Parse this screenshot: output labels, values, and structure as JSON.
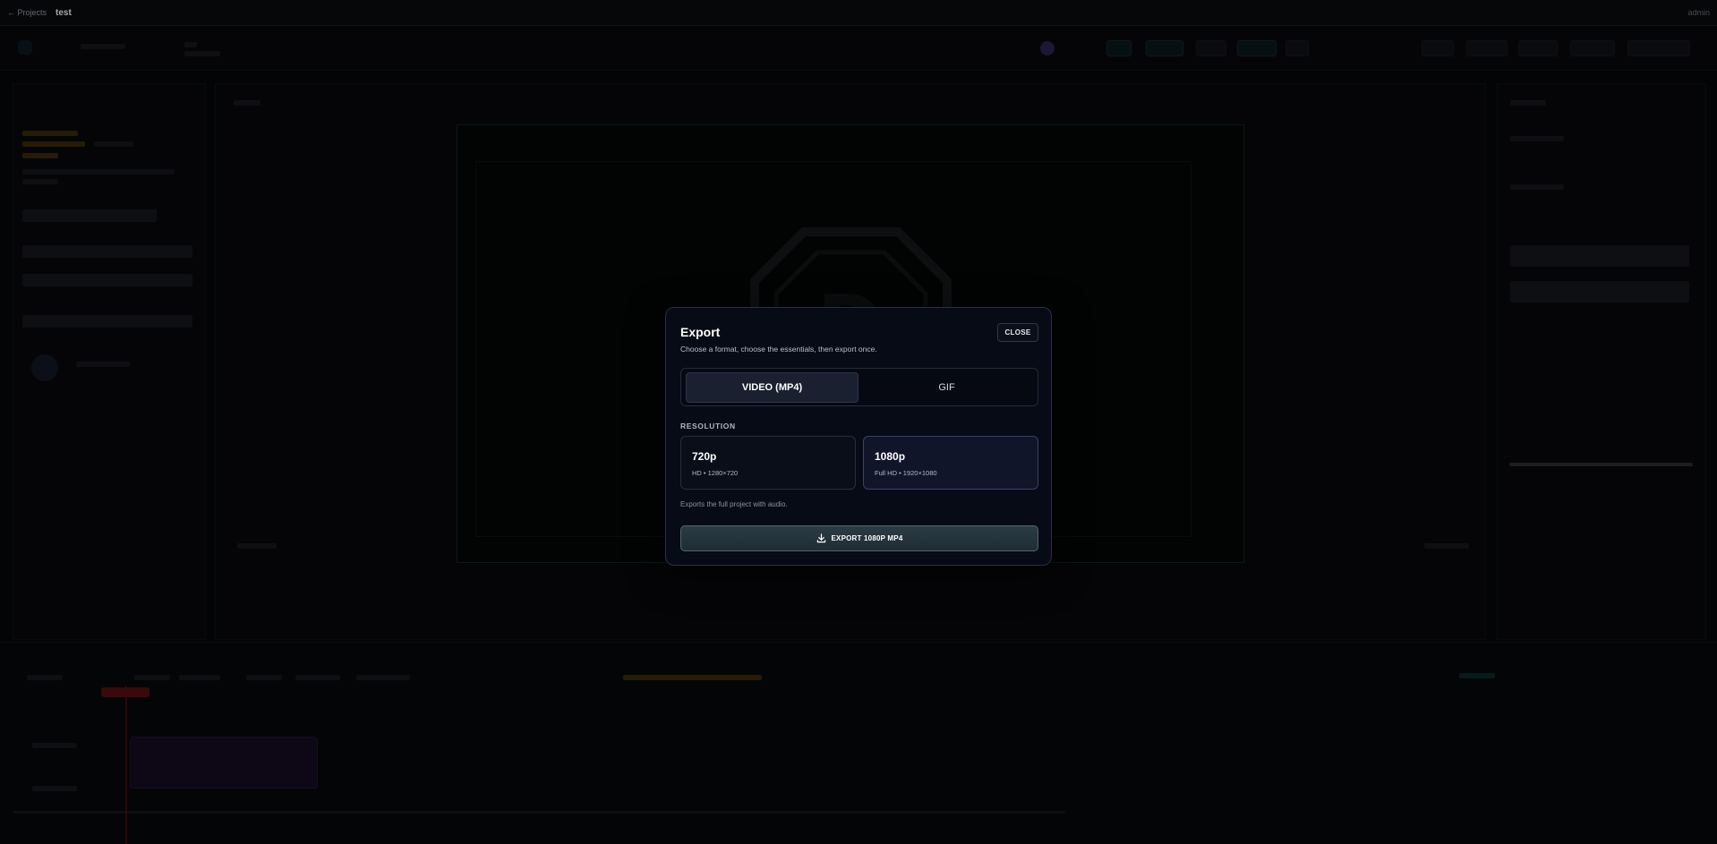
{
  "topbar": {
    "back_label": "← Projects",
    "project_name": "test",
    "user": "admin"
  },
  "modal": {
    "title": "Export",
    "subtitle": "Choose a format, choose the essentials, then export once.",
    "close_label": "CLOSE",
    "format_tabs": [
      {
        "label": "VIDEO (MP4)",
        "selected": true
      },
      {
        "label": "GIF",
        "selected": false
      }
    ],
    "resolution_heading": "RESOLUTION",
    "resolutions": [
      {
        "name": "720p",
        "description": "HD • 1280×720",
        "selected": false
      },
      {
        "name": "1080p",
        "description": "Full HD • 1920×1080",
        "selected": true
      }
    ],
    "note": "Exports the full project with audio.",
    "export_label": "EXPORT 1080P MP4"
  },
  "icons": {
    "download": "download-icon"
  },
  "colors": {
    "modal_bg": "#070b16",
    "accent": "#2b3c45"
  }
}
